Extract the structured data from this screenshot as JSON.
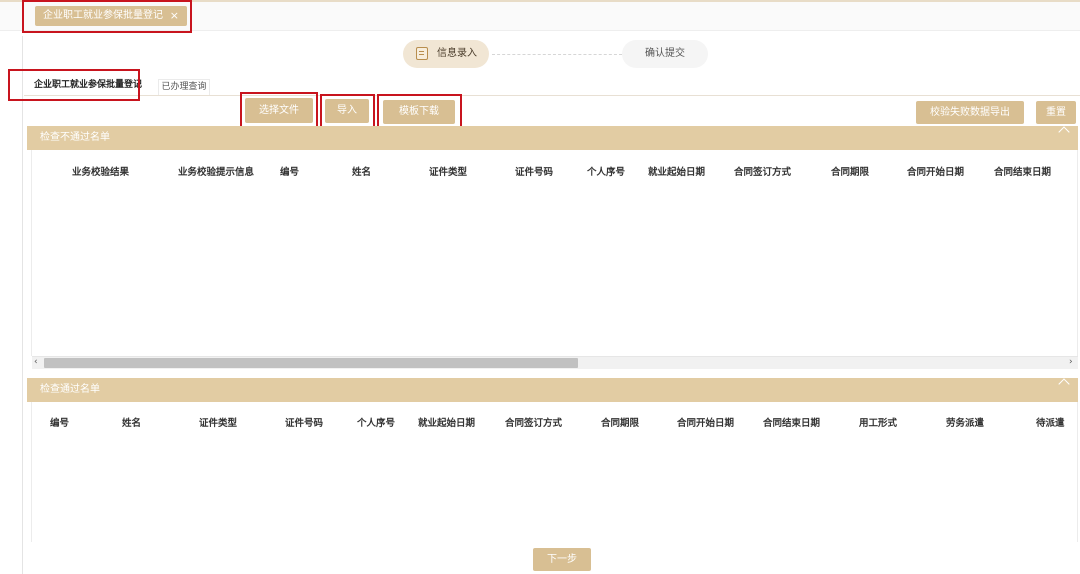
{
  "window_tab": {
    "title": "企业职工就业参保批量登记",
    "close": "×"
  },
  "stepper": {
    "step1": "信息录入",
    "step2": "确认提交",
    "step1_icon": "form-edit-icon"
  },
  "subtabs": {
    "active": "企业职工就业参保批量登记",
    "query": "已办理查询"
  },
  "toolbar": {
    "choose_file": "选择文件",
    "import": "导入",
    "template_download": "模板下载",
    "export_failed": "校验失败数据导出",
    "reset": "重置"
  },
  "failed_panel": {
    "title": "检查不通过名单",
    "columns": [
      "业务校验结果",
      "业务校验提示信息",
      "编号",
      "姓名",
      "证件类型",
      "证件号码",
      "个人序号",
      "就业起始日期",
      "合同签订方式",
      "合同期限",
      "合同开始日期",
      "合同结束日期"
    ]
  },
  "scrollbar": {
    "left": "‹",
    "right": "›"
  },
  "passed_panel": {
    "title": "检查通过名单",
    "columns": [
      "编号",
      "姓名",
      "证件类型",
      "证件号码",
      "个人序号",
      "就业起始日期",
      "合同签订方式",
      "合同期限",
      "合同开始日期",
      "合同结束日期",
      "用工形式",
      "劳务派遣",
      "待派遣"
    ]
  },
  "footer": {
    "next": "下一步"
  },
  "colors": {
    "accent": "#d8bf93",
    "panel_header": "#e2cca3",
    "highlight": "#c8141e"
  }
}
